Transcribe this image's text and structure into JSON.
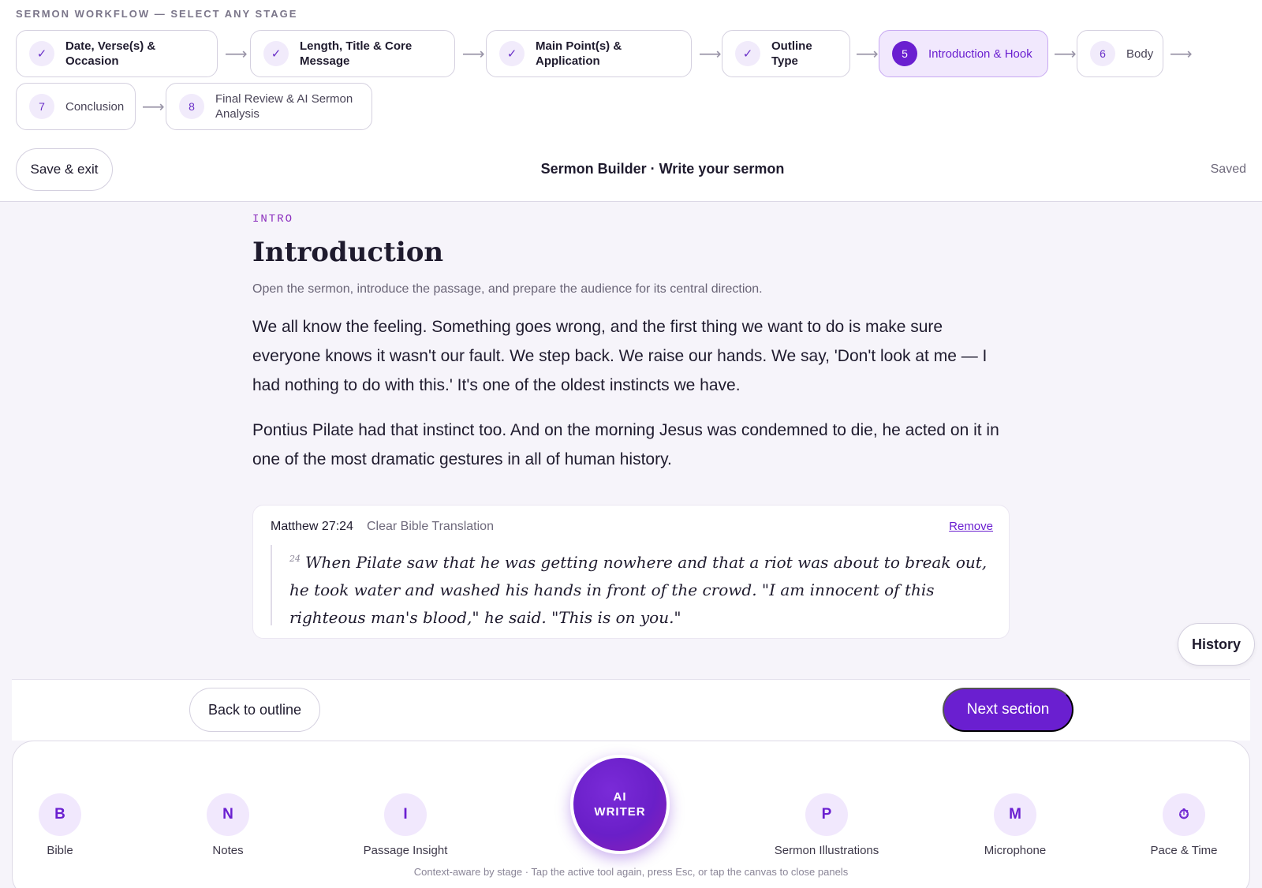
{
  "workflow": {
    "label": "SERMON WORKFLOW — SELECT ANY STAGE",
    "steps": [
      {
        "num": "✓",
        "label": "Date, Verse(s) & Occasion",
        "state": "done"
      },
      {
        "num": "✓",
        "label": "Length, Title & Core Message",
        "state": "done"
      },
      {
        "num": "✓",
        "label": "Main Point(s) & Application",
        "state": "done"
      },
      {
        "num": "✓",
        "label": "Outline Type",
        "state": "done"
      },
      {
        "num": "5",
        "label": "Introduction & Hook",
        "state": "active"
      },
      {
        "num": "6",
        "label": "Body",
        "state": "pending"
      },
      {
        "num": "7",
        "label": "Conclusion",
        "state": "pending"
      },
      {
        "num": "8",
        "label": "Final Review & AI Sermon Analysis",
        "state": "pending"
      }
    ],
    "arrow": "⟶"
  },
  "topbar": {
    "save_exit": "Save & exit",
    "title": "Sermon Builder · Write your sermon",
    "status": "Saved"
  },
  "section": {
    "tag": "INTRO",
    "title": "Introduction",
    "description": "Open the sermon, introduce the passage, and prepare the audience for its central direction.",
    "paragraphs": [
      "We all know the feeling. Something goes wrong, and the first thing we want to do is make sure everyone knows it wasn't our fault. We step back. We raise our hands. We say, 'Don't look at me — I had nothing to do with this.' It's one of the oldest instincts we have.",
      "Pontius Pilate had that instinct too. And on the morning Jesus was condemned to die, he acted on it in one of the most dramatic gestures in all of human history."
    ]
  },
  "scripture": {
    "reference": "Matthew 27:24",
    "translation": "Clear Bible Translation",
    "remove": "Remove",
    "verse_num": "24",
    "text": "When Pilate saw that he was getting nowhere and that a riot was about to break out, he took water and washed his hands in front of the crowd. \"I am innocent of this righteous man's blood,\" he said. \"This is on you.\""
  },
  "history": "History",
  "nav": {
    "back": "Back to outline",
    "next": "Next section"
  },
  "tools": {
    "items": [
      {
        "icon": "B",
        "label": "Bible"
      },
      {
        "icon": "N",
        "label": "Notes"
      },
      {
        "icon": "I",
        "label": "Passage Insight"
      },
      {
        "icon": "P",
        "label": "Sermon Illustrations"
      },
      {
        "icon": "M",
        "label": "Microphone"
      },
      {
        "icon": "⏱",
        "label": "Pace & Time"
      }
    ],
    "ai_writer_line1": "AI",
    "ai_writer_line2": "WRITER",
    "hint": "Context-aware by stage · Tap the active tool again, press Esc, or tap the canvas to close panels"
  },
  "colors": {
    "accent": "#6a1fd0",
    "accent_light": "#f1e8fd",
    "tag": "#8a2bbd"
  }
}
